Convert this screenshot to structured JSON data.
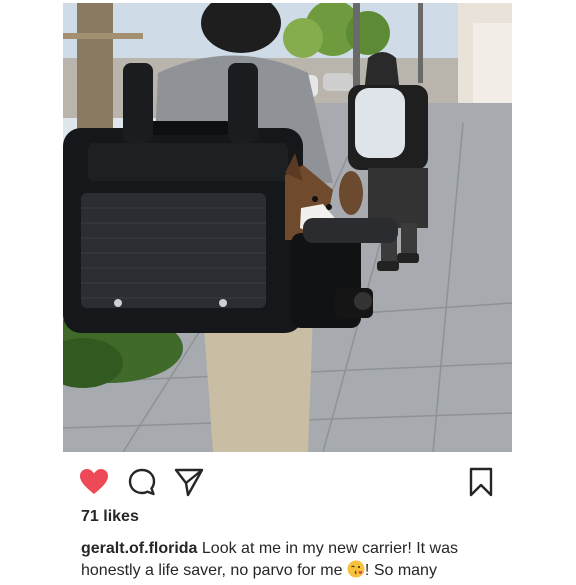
{
  "post": {
    "photo_alt": "Person carrying a dog in a backpack carrier on a sidewalk",
    "likes": {
      "count": "71",
      "word": "likes"
    },
    "caption": {
      "username": "geralt.of.florida",
      "text_before_emoji": "Look at me in my new carrier! It was honestly a life saver, no parvo for me ",
      "emoji": "kissing-face-emoji",
      "text_after_emoji": "! So many"
    }
  },
  "actions": {
    "like_icon": "heart-icon",
    "comment_icon": "comment-icon",
    "share_icon": "send-icon",
    "save_icon": "bookmark-icon"
  },
  "colors": {
    "liked": "#ed4956",
    "icon_stroke": "#262626",
    "text": "#262626",
    "background": "#ffffff"
  }
}
